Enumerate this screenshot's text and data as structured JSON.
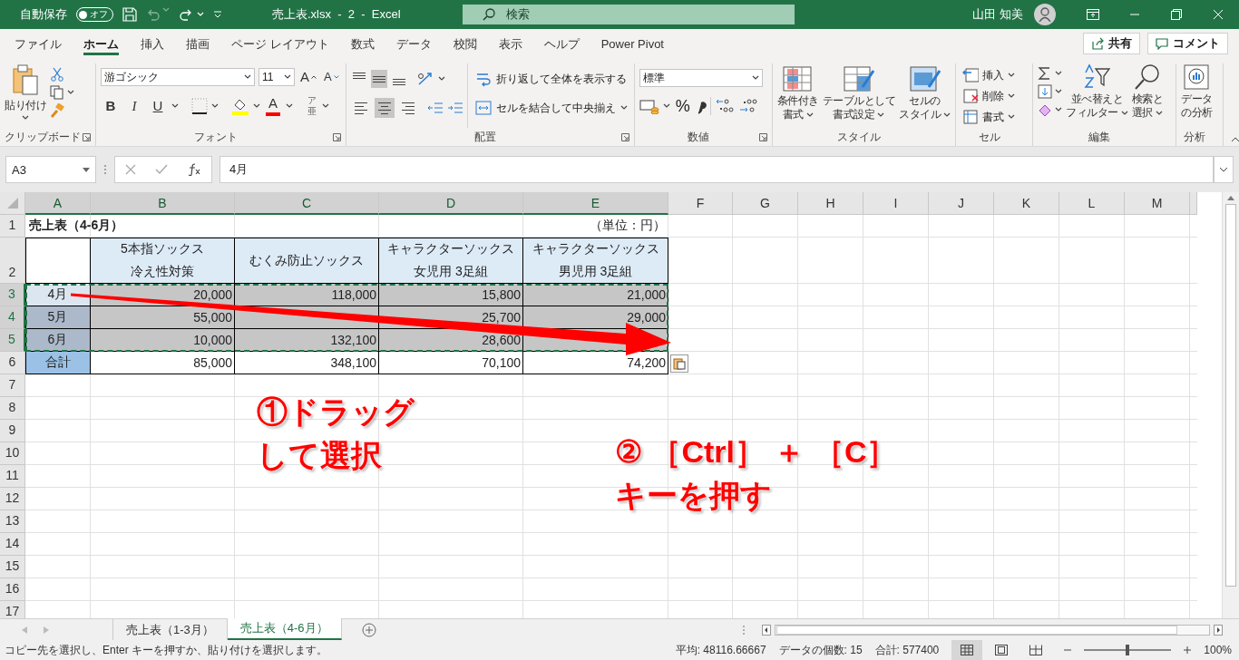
{
  "title_bar": {
    "autosave_label": "自動保存",
    "autosave_toggle": {
      "label": "オフ",
      "on": false
    },
    "title": "売上表.xlsx  -  2  -  Excel",
    "search_placeholder": "検索",
    "user": "山田 知美"
  },
  "menu_tabs": [
    {
      "label": "ファイル",
      "selected": false
    },
    {
      "label": "ホーム",
      "selected": true
    },
    {
      "label": "挿入",
      "selected": false
    },
    {
      "label": "描画",
      "selected": false
    },
    {
      "label": "ページ レイアウト",
      "selected": false
    },
    {
      "label": "数式",
      "selected": false
    },
    {
      "label": "データ",
      "selected": false
    },
    {
      "label": "校閲",
      "selected": false
    },
    {
      "label": "表示",
      "selected": false
    },
    {
      "label": "ヘルプ",
      "selected": false
    },
    {
      "label": "Power Pivot",
      "selected": false
    }
  ],
  "share_button": "共有",
  "comment_button": "コメント",
  "ribbon": [
    {
      "kind": "clipboard",
      "label": "クリップボード",
      "paste": "貼り付け"
    },
    {
      "kind": "font",
      "label": "フォント",
      "font_name": "游ゴシック",
      "font_size": "11",
      "grow_label": "A",
      "shrink_label": "A",
      "style_buttons": [
        "B",
        "I",
        "U"
      ],
      "font_color_label": "A",
      "phonetic": [
        "ア",
        "亜"
      ]
    },
    {
      "kind": "alignment",
      "label": "配置",
      "valign": [
        {
          "selected": false
        },
        {
          "selected": true
        },
        {
          "selected": false
        }
      ],
      "halign": [
        {
          "selected": false
        },
        {
          "selected": true
        },
        {
          "selected": false
        }
      ],
      "wrap": "折り返して全体を表示する",
      "merge": "セルを結合して中央揃え"
    },
    {
      "kind": "number",
      "label": "数値",
      "format": "標準",
      "percent": "%"
    },
    {
      "kind": "styles",
      "label": "スタイル",
      "buttons": [
        {
          "lines": [
            "条件付き",
            "書式"
          ]
        },
        {
          "lines": [
            "テーブルとして",
            "書式設定"
          ]
        },
        {
          "lines": [
            "セルの",
            "スタイル"
          ]
        }
      ]
    },
    {
      "kind": "cells",
      "label": "セル",
      "buttons": [
        "挿入",
        "削除",
        "書式"
      ]
    },
    {
      "kind": "editing",
      "label": "編集",
      "buttons": [
        {
          "lines": [
            "並べ替えと",
            "フィルター"
          ]
        },
        {
          "lines": [
            "検索と",
            "選択"
          ]
        }
      ]
    },
    {
      "kind": "analysis",
      "label": "分析",
      "buttons": [
        {
          "lines": [
            "データ",
            "の分析"
          ]
        }
      ]
    }
  ],
  "formula_bar": {
    "name_box": "A3",
    "formula": "4月"
  },
  "sheet": {
    "columns": [
      {
        "label": "A",
        "selected": true
      },
      {
        "label": "B",
        "selected": true
      },
      {
        "label": "C",
        "selected": true
      },
      {
        "label": "D",
        "selected": true
      },
      {
        "label": "E",
        "selected": true
      },
      {
        "label": "F",
        "selected": false
      },
      {
        "label": "G",
        "selected": false
      },
      {
        "label": "H",
        "selected": false
      },
      {
        "label": "I",
        "selected": false
      },
      {
        "label": "J",
        "selected": false
      },
      {
        "label": "K",
        "selected": false
      },
      {
        "label": "L",
        "selected": false
      },
      {
        "label": "M",
        "selected": false
      }
    ],
    "rows": [
      {
        "number": "1",
        "selected": false,
        "cells": [
          {
            "kind": "title",
            "text": "売上表（4-6月）",
            "selected": false
          },
          {
            "kind": "blank",
            "selected": false
          },
          {
            "kind": "blank",
            "selected": false
          },
          {
            "kind": "unit",
            "text": "（単位：円）",
            "selected": false
          }
        ]
      },
      {
        "number": "2",
        "selected": false,
        "cells": [
          {
            "kind": "corner",
            "selected": false
          },
          {
            "kind": "header",
            "lines": [
              "5本指ソックス",
              "冷え性対策"
            ],
            "selected": false
          },
          {
            "kind": "header",
            "lines": [
              "むくみ防止ソックス"
            ],
            "selected": false
          },
          {
            "kind": "header",
            "lines": [
              "キャラクターソックス",
              "女児用 3足組"
            ],
            "selected": false
          },
          {
            "kind": "header",
            "lines": [
              "キャラクターソックス",
              "男児用 3足組"
            ],
            "selected": false
          }
        ]
      },
      {
        "number": "3",
        "selected": true,
        "cells": [
          {
            "kind": "month",
            "text": "4月",
            "selected": true
          },
          {
            "kind": "number",
            "text": "20,000",
            "selected": true
          },
          {
            "kind": "number",
            "text": "118,000",
            "selected": true
          },
          {
            "kind": "number",
            "text": "15,800",
            "selected": true
          },
          {
            "kind": "number",
            "text": "21,000",
            "selected": true
          }
        ]
      },
      {
        "number": "4",
        "selected": true,
        "cells": [
          {
            "kind": "month",
            "text": "5月",
            "selected": true
          },
          {
            "kind": "number",
            "text": "55,000",
            "selected": true
          },
          {
            "kind": "number",
            "selected": true
          },
          {
            "kind": "number",
            "text": "25,700",
            "selected": true
          },
          {
            "kind": "number",
            "text": "29,000",
            "selected": true
          }
        ]
      },
      {
        "number": "5",
        "selected": true,
        "cells": [
          {
            "kind": "month",
            "text": "6月",
            "selected": true
          },
          {
            "kind": "number",
            "text": "10,000",
            "selected": true
          },
          {
            "kind": "number",
            "text": "132,100",
            "selected": true
          },
          {
            "kind": "number",
            "text": "28,600",
            "selected": true
          },
          {
            "kind": "number",
            "selected": true
          }
        ]
      },
      {
        "number": "6",
        "selected": false,
        "cells": [
          {
            "kind": "total_label",
            "text": "合計",
            "selected": false
          },
          {
            "kind": "number",
            "text": "85,000",
            "selected": false
          },
          {
            "kind": "number",
            "text": "348,100",
            "selected": false
          },
          {
            "kind": "number",
            "text": "70,100",
            "selected": false
          },
          {
            "kind": "number",
            "text": "74,200",
            "selected": false
          }
        ]
      },
      {
        "number": "7",
        "selected": false
      },
      {
        "number": "8",
        "selected": false
      },
      {
        "number": "9",
        "selected": false
      },
      {
        "number": "10",
        "selected": false
      },
      {
        "number": "11",
        "selected": false
      },
      {
        "number": "12",
        "selected": false
      },
      {
        "number": "13",
        "selected": false
      },
      {
        "number": "14",
        "selected": false
      },
      {
        "number": "15",
        "selected": false
      },
      {
        "number": "16",
        "selected": false
      },
      {
        "number": "17",
        "selected": false
      }
    ]
  },
  "annotations": [
    {
      "lines": [
        "①ドラッグ",
        "して選択"
      ]
    },
    {
      "lines": [
        "② ［Ctrl］ ＋ ［C］",
        "キーを押す"
      ]
    }
  ],
  "sheet_tabs": [
    {
      "label": "売上表（1-3月）",
      "selected": false
    },
    {
      "label": "売上表（4-6月）",
      "selected": true
    }
  ],
  "status_bar": {
    "message": "コピー先を選択し、Enter キーを押すか、貼り付けを選択します。",
    "average": "平均: 48116.66667",
    "count": "データの個数: 15",
    "sum": "合計: 577400",
    "views": [
      {
        "selected": true
      },
      {
        "selected": false
      },
      {
        "selected": false
      }
    ],
    "zoom_slider": {
      "level": 0.5
    },
    "zoom": "100%"
  }
}
